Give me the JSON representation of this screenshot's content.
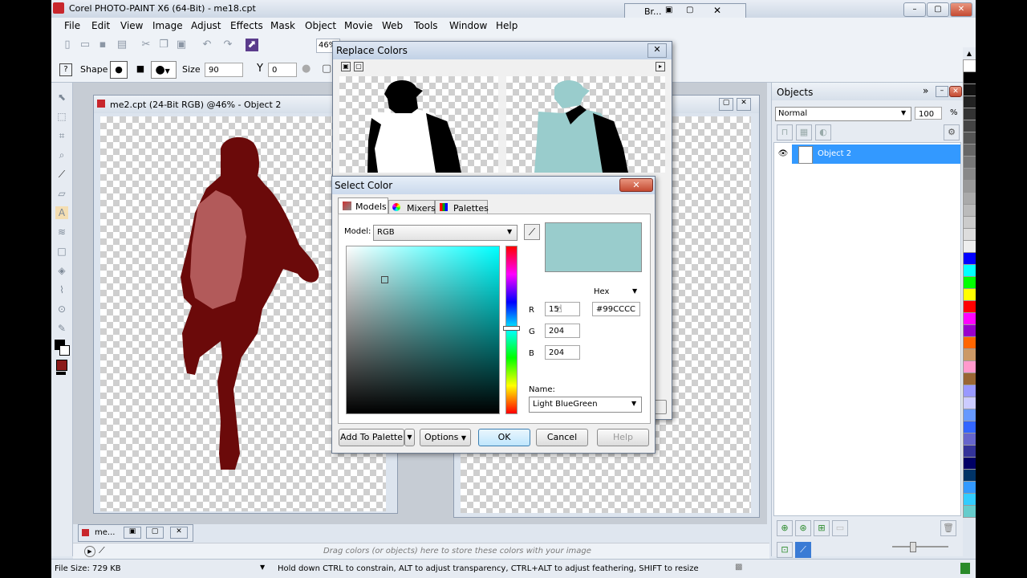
{
  "app": {
    "title": "Corel PHOTO-PAINT X6 (64-Bit) - me18.cpt",
    "menu": [
      "File",
      "Edit",
      "View",
      "Image",
      "Adjust",
      "Effects",
      "Mask",
      "Object",
      "Movie",
      "Web",
      "Tools",
      "Window",
      "Help"
    ],
    "zoom": "46%",
    "small_window_title": "Br..."
  },
  "propbar": {
    "shape_label": "Shape",
    "size_label": "Size",
    "size_value": "90",
    "transparency_value": "0"
  },
  "doc": {
    "title": "me2.cpt (24-Bit RGB) @46% - Object 2",
    "minimized_title": "me...",
    "silhouette_color": "#6b0a0a",
    "highlight_color": "#b25a5a"
  },
  "replace_colors": {
    "title": "Replace Colors",
    "preview_tint": "#99cccc"
  },
  "select_color": {
    "title": "Select Color",
    "tabs": [
      "Models",
      "Mixers",
      "Palettes"
    ],
    "model_label": "Model:",
    "model_value": "RGB",
    "format_label": "Hex",
    "r_label": "R",
    "g_label": "G",
    "b_label": "B",
    "r_value": "15",
    "g_value": "204",
    "b_value": "204",
    "hex_value": "#99CCCC",
    "name_label": "Name:",
    "name_value": "Light BlueGreen",
    "preview_color": "#99cccc",
    "buttons": {
      "add_to_palette": "Add To Palette",
      "options": "Options",
      "ok": "OK",
      "cancel": "Cancel",
      "help": "Help"
    }
  },
  "objects_panel": {
    "title": "Objects",
    "blend_mode": "Normal",
    "opacity": "100",
    "opacity_unit": "%",
    "layer_name": "Object 2"
  },
  "palette_colors": [
    "#ffffff",
    "#000000",
    "#111111",
    "#222222",
    "#333333",
    "#444444",
    "#555555",
    "#666666",
    "#777777",
    "#888888",
    "#999999",
    "#aaaaaa",
    "#bbbbbb",
    "#cccccc",
    "#dddddd",
    "#eeeeee",
    "#0000ff",
    "#00ffff",
    "#00ff00",
    "#ffff00",
    "#ff0000",
    "#ff00ff",
    "#9900cc",
    "#ff6600",
    "#cc9966",
    "#ff99cc",
    "#996633",
    "#9999ff",
    "#ccccff",
    "#6699ff",
    "#3366ff",
    "#6666cc",
    "#333399",
    "#000066",
    "#003366",
    "#3399ff",
    "#33ccff",
    "#66cccc"
  ],
  "status": {
    "swatch_hint": "Drag colors (or objects) here to store these colors with your image",
    "file_size": "File Size: 729 KB",
    "hint": "Hold down CTRL to constrain, ALT to adjust transparency, CTRL+ALT to adjust feathering, SHIFT to resize"
  }
}
